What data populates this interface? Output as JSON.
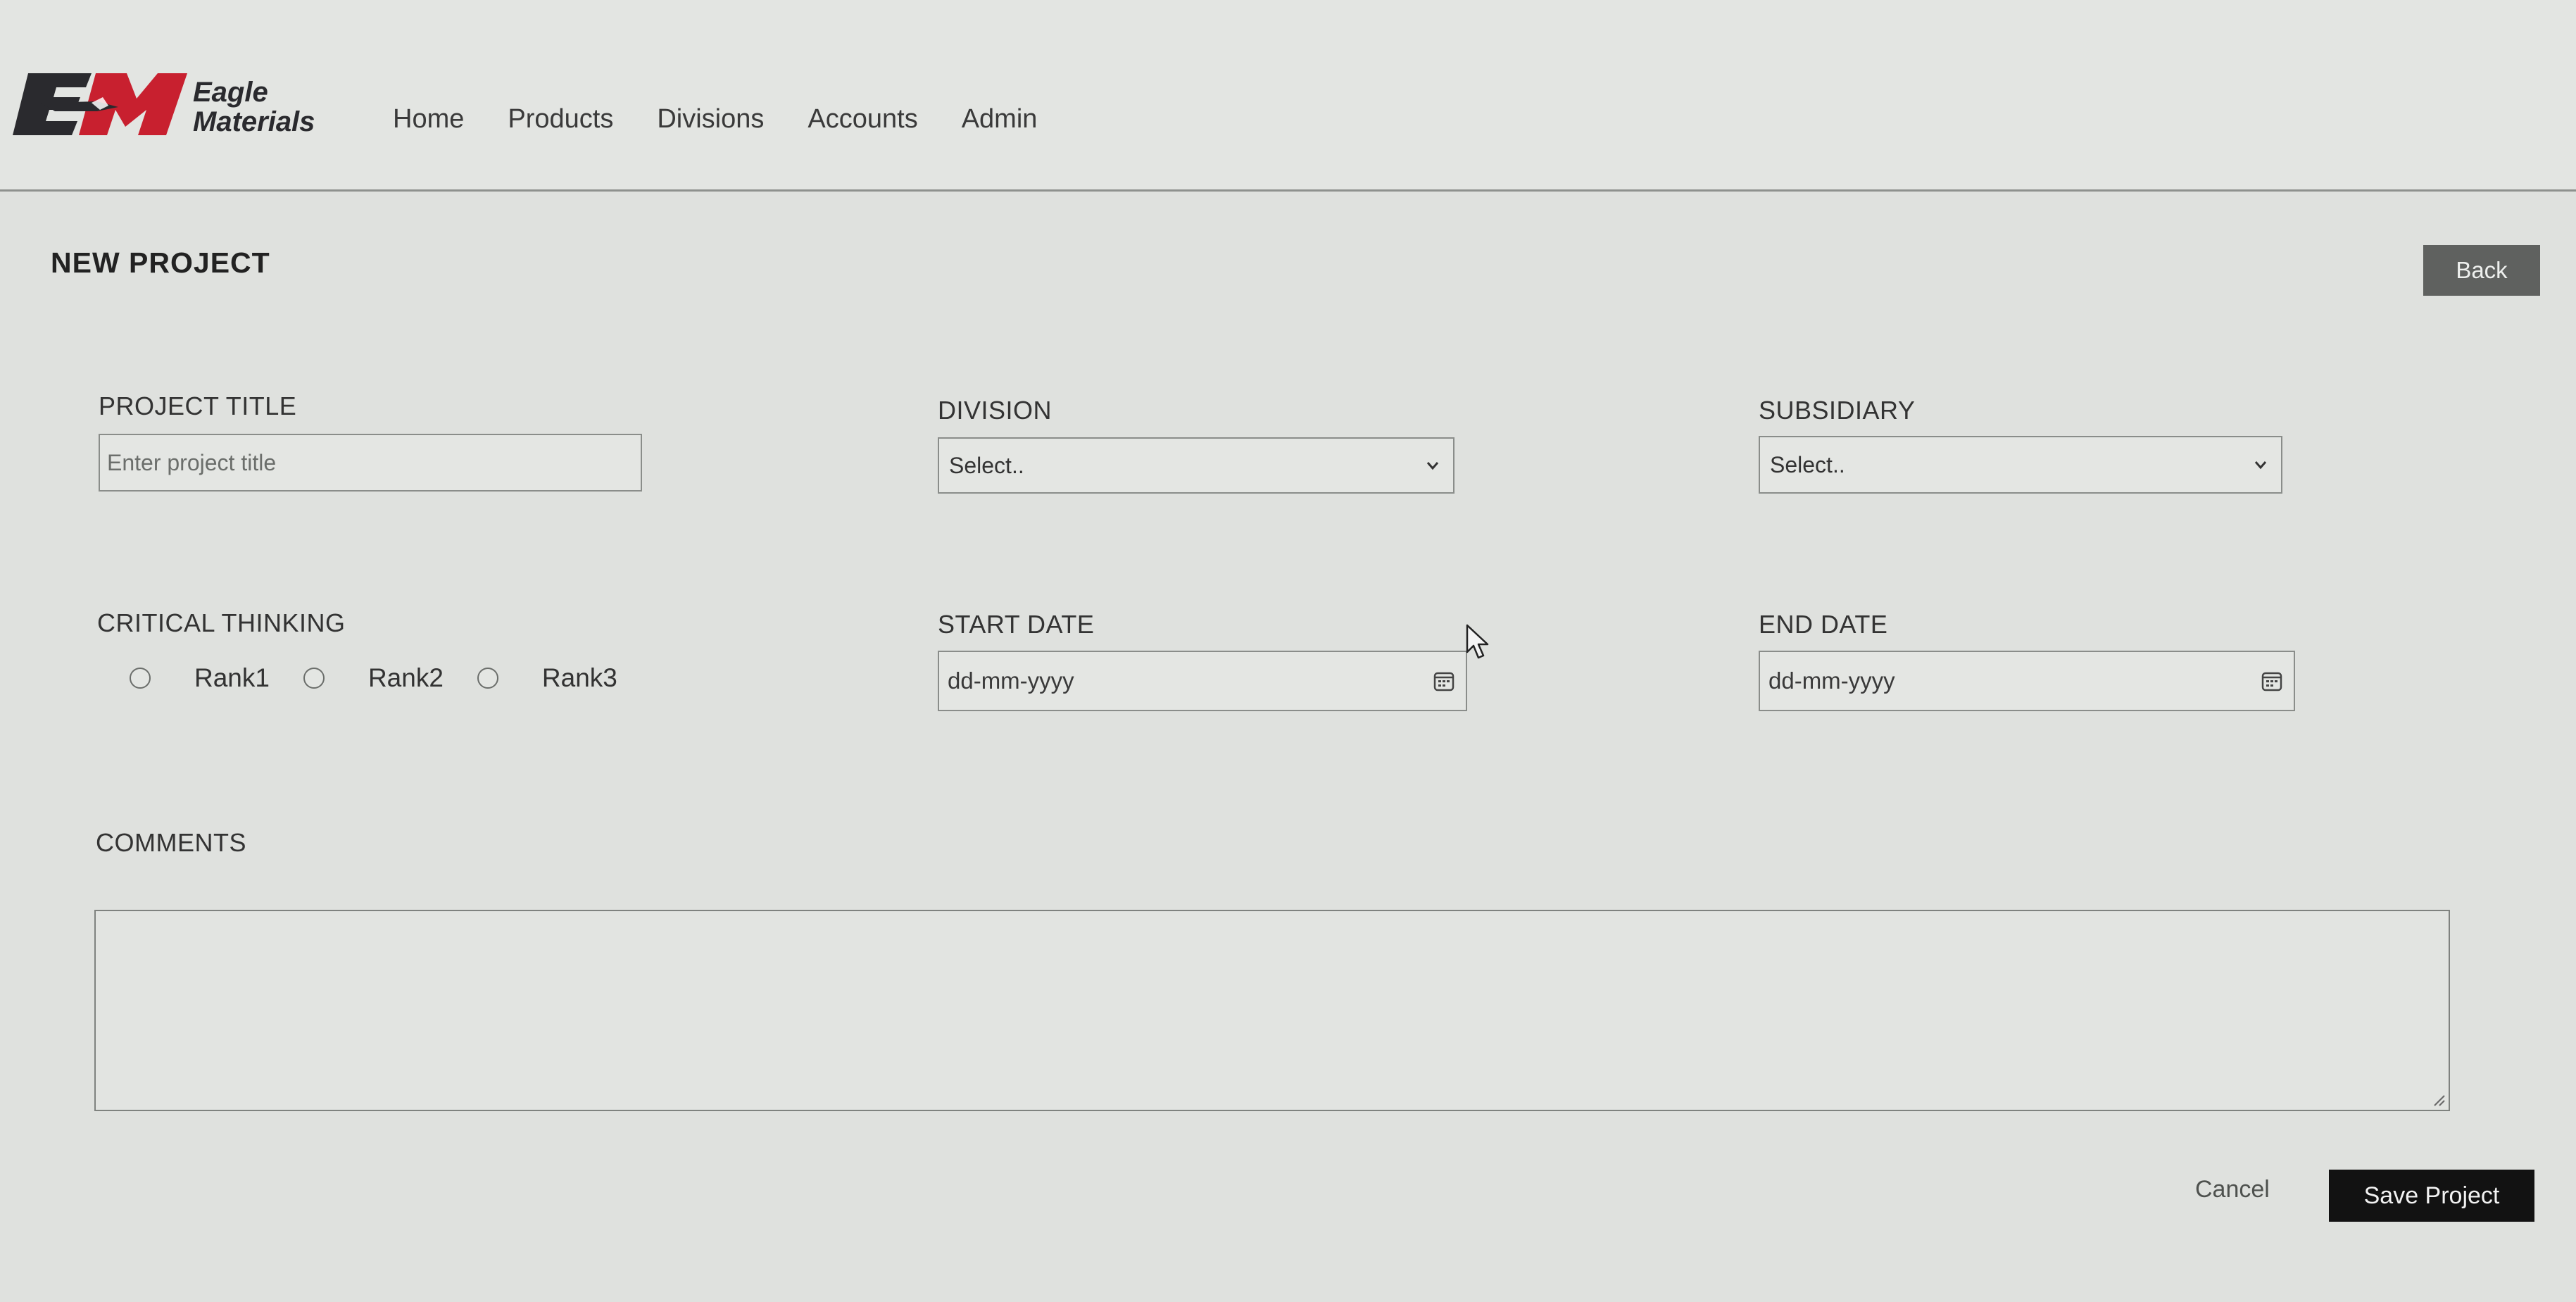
{
  "brand": {
    "logo_mark": "EM",
    "logo_line1": "Eagle",
    "logo_line2": "Materials",
    "logo_red": "#c8202f",
    "logo_dark": "#2a2a2e"
  },
  "nav": {
    "items": [
      "Home",
      "Products",
      "Divisions",
      "Accounts",
      "Admin"
    ]
  },
  "page": {
    "title": "NEW PROJECT",
    "back_label": "Back"
  },
  "form": {
    "project_title": {
      "label": "PROJECT TITLE",
      "placeholder": "Enter project title",
      "value": ""
    },
    "division": {
      "label": "DIVISION",
      "selected": "Select.."
    },
    "subsidiary": {
      "label": "SUBSIDIARY",
      "selected": "Select.."
    },
    "critical_thinking": {
      "label": "CRITICAL THINKING",
      "options": [
        "Rank1",
        "Rank2",
        "Rank3"
      ],
      "selected": null
    },
    "start_date": {
      "label": "START DATE",
      "value": "dd-mm-yyyy"
    },
    "end_date": {
      "label": "END DATE",
      "value": "dd-mm-yyyy"
    },
    "comments": {
      "label": "COMMENTS",
      "value": ""
    }
  },
  "actions": {
    "cancel_label": "Cancel",
    "save_label": "Save Project"
  },
  "icons": {
    "select_arrow": "chevron-down-icon",
    "date_picker": "calendar-icon",
    "pointer": "mouse-cursor-icon"
  }
}
